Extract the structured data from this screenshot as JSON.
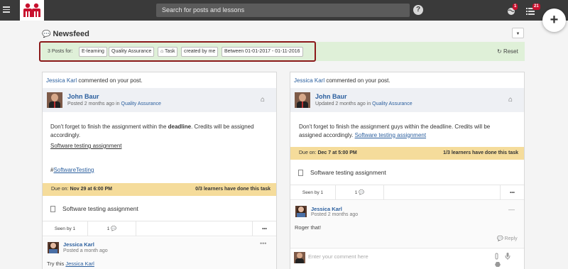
{
  "topbar": {
    "search_placeholder": "Search for posts and lessons",
    "help_glyph": "?",
    "notifications_count": "1",
    "tasks_count": "21",
    "fab_glyph": "+"
  },
  "page": {
    "title": "Newsfeed",
    "filter_button_glyph": "▼"
  },
  "filter": {
    "posts_for": "3 Posts for:",
    "chips": [
      "E-learning",
      "Quality Assurance",
      "Task",
      "created by me",
      "Between 01-01-2017 - 01-11-2016"
    ],
    "reset": "Reset"
  },
  "posts": [
    {
      "notice_user": "Jessica Karl",
      "notice_text": " commented on your post.",
      "author": "John Baur",
      "posted": "Posted 2 months ago in ",
      "group": "Quality Assurance",
      "body_pre": "Don't forget to finish the assignment within the ",
      "body_bold": "deadline",
      "body_post": ". Credits will be assigned accordingly.",
      "link": "Software testing assignment",
      "hashtag_prefix": "#",
      "hashtag": "SoftwareTesting",
      "due_label": "Due on: ",
      "due_value": "Nov 29 at 6:00 PM",
      "learners": "0/3 learners have done this task",
      "assignment": "Software testing assignment",
      "seen_by": "Seen by 1",
      "comments_count": "1",
      "more": "•••",
      "comment": {
        "name": "Jessica Karl",
        "time": "Posted a month ago",
        "text_pre": "Try this ",
        "text_link": "Jessica Karl",
        "menu": "•••"
      }
    },
    {
      "notice_user": "Jessica Karl",
      "notice_text": " commented on your post.",
      "author": "John Baur",
      "posted": "Updated 2 months ago in ",
      "group": "Quality Assurance",
      "body_pre": "Don't forget to finish the assignment guys within the deadline. Credits will be assigned accordingly. ",
      "link": "Software testing assignment",
      "due_label": "Due on: ",
      "due_value": "Dec 7 at 5:00 PM",
      "learners": "1/3 learners have done this task",
      "assignment": "Software testing assignment",
      "seen_by": "Seen by 1",
      "comments_count": "1",
      "more": "•••",
      "comment": {
        "name": "Jessica Karl",
        "time": "Posted 2 months ago",
        "text": "Roger that!",
        "reply": "Reply",
        "menu": "—"
      },
      "comment_placeholder": "Enter your comment here"
    }
  ],
  "colors": {
    "topbar": "#3a3a3a",
    "brand": "#c8102e",
    "link": "#2b5f9e",
    "filter_bar": "#dff0d8",
    "due_bar": "#f5dc9b",
    "highlight_border": "#8b1a1a"
  }
}
